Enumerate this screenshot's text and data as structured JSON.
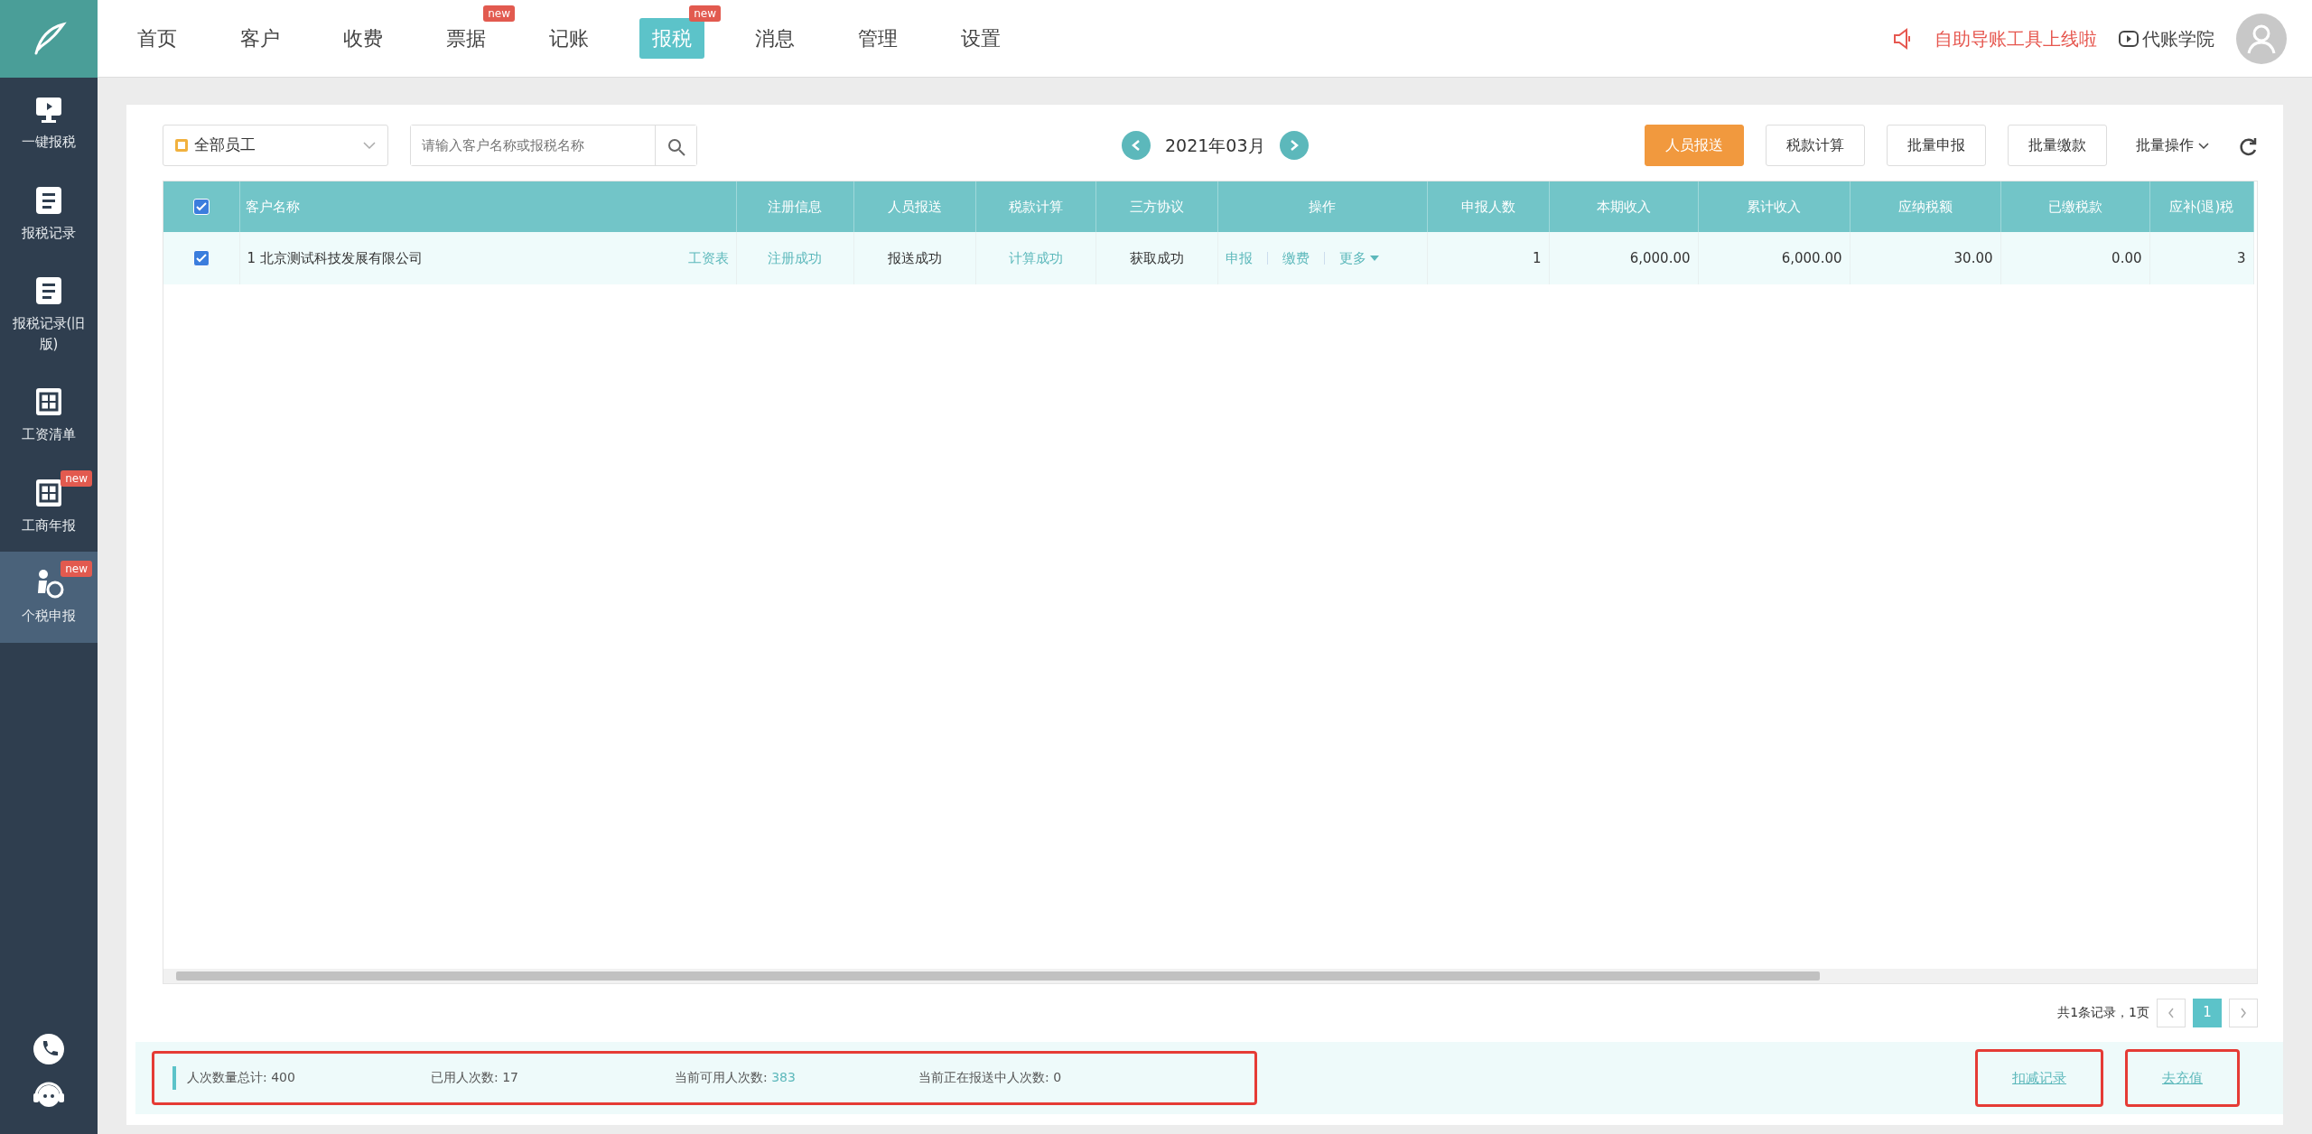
{
  "nav": [
    {
      "label": "首页",
      "selected": false
    },
    {
      "label": "客户",
      "selected": false
    },
    {
      "label": "收费",
      "selected": false
    },
    {
      "label": "票据",
      "selected": false,
      "badge": "new"
    },
    {
      "label": "记账",
      "selected": false
    },
    {
      "label": "报税",
      "selected": true,
      "badge": "new"
    },
    {
      "label": "消息",
      "selected": false
    },
    {
      "label": "管理",
      "selected": false
    },
    {
      "label": "设置",
      "selected": false
    }
  ],
  "notice": "自助导账工具上线啦",
  "academy": "代账学院",
  "sidebar": [
    {
      "label": "一键报税",
      "selected": false
    },
    {
      "label": "报税记录",
      "selected": false
    },
    {
      "label": "报税记录(旧版)",
      "selected": false
    },
    {
      "label": "工资清单",
      "selected": false
    },
    {
      "label": "工商年报",
      "selected": false,
      "badge": "new"
    },
    {
      "label": "个税申报",
      "selected": true,
      "badge": "new"
    }
  ],
  "toolbar": {
    "staff": "全部员工",
    "search_placeholder": "请输入客户名称或报税名称",
    "period": "2021年03月",
    "buttons": [
      {
        "label": "人员报送",
        "kind": "primary"
      },
      {
        "label": "税款计算",
        "kind": "plain"
      },
      {
        "label": "批量申报",
        "kind": "plain"
      },
      {
        "label": "批量缴款",
        "kind": "plain"
      },
      {
        "label": "批量操作",
        "kind": "dropdown"
      }
    ]
  },
  "table": {
    "all_checked": true,
    "columns": [
      "客户名称",
      "注册信息",
      "人员报送",
      "税款计算",
      "三方协议",
      "操作",
      "申报人数",
      "本期收入",
      "累计收入",
      "应纳税额",
      "已缴税款",
      "应补(退)税"
    ],
    "rows": [
      {
        "checked": true,
        "name": "1 北京测试科技发展有限公司",
        "link": "工资表",
        "register": "注册成功",
        "report": "报送成功",
        "calc": "计算成功",
        "agreement": "获取成功",
        "actions": [
          "申报",
          "缴费",
          "更多"
        ],
        "people": "1",
        "income": "6,000.00",
        "total_income": "6,000.00",
        "tax_due": "30.00",
        "tax_paid": "0.00",
        "refund": "3"
      }
    ]
  },
  "pagination": {
    "summary": "共1条记录，1页",
    "pages": [
      {
        "label": "1",
        "selected": true
      }
    ]
  },
  "stats": [
    {
      "label": "人次数量总计: ",
      "value": "400",
      "highlight": false
    },
    {
      "label": "已用人次数: ",
      "value": "17",
      "highlight": false
    },
    {
      "label": "当前可用人次数: ",
      "value": "383",
      "highlight": true
    },
    {
      "label": "当前正在报送中人次数: ",
      "value": "0",
      "highlight": false
    }
  ],
  "links": [
    "扣减记录",
    "去充值"
  ]
}
